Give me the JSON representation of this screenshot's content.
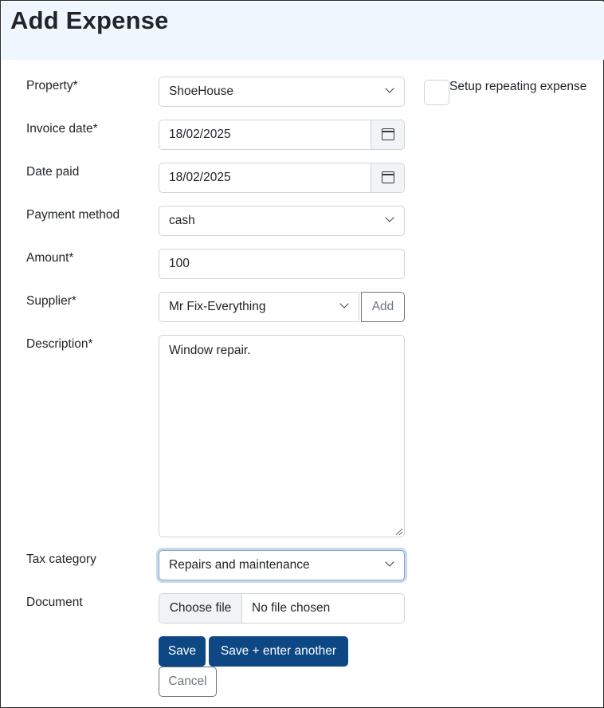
{
  "header": {
    "title": "Add Expense"
  },
  "labels": {
    "property": "Property*",
    "invoice_date": "Invoice date*",
    "date_paid": "Date paid",
    "payment_method": "Payment method",
    "amount": "Amount*",
    "supplier": "Supplier*",
    "description": "Description*",
    "tax_category": "Tax category",
    "document": "Document"
  },
  "fields": {
    "property": "ShoeHouse",
    "invoice_date": "18/02/2025",
    "date_paid": "18/02/2025",
    "payment_method": "cash",
    "amount": "100",
    "supplier": "Mr Fix-Everything",
    "description": "Window repair.",
    "tax_category": "Repairs and maintenance",
    "document_button": "Choose file",
    "document_status": "No file chosen"
  },
  "repeating": {
    "label": "Setup repeating expense",
    "checked": false
  },
  "buttons": {
    "add_supplier": "Add",
    "save": "Save",
    "save_another": "Save + enter another",
    "cancel": "Cancel"
  },
  "icons": {
    "select": "chevron-down-icon",
    "date": "calendar-icon",
    "resize": "resize-grip-icon"
  },
  "colors": {
    "header_bg": "#f0f6fd",
    "primary": "#0d4784",
    "secondary": "#6c757d"
  }
}
